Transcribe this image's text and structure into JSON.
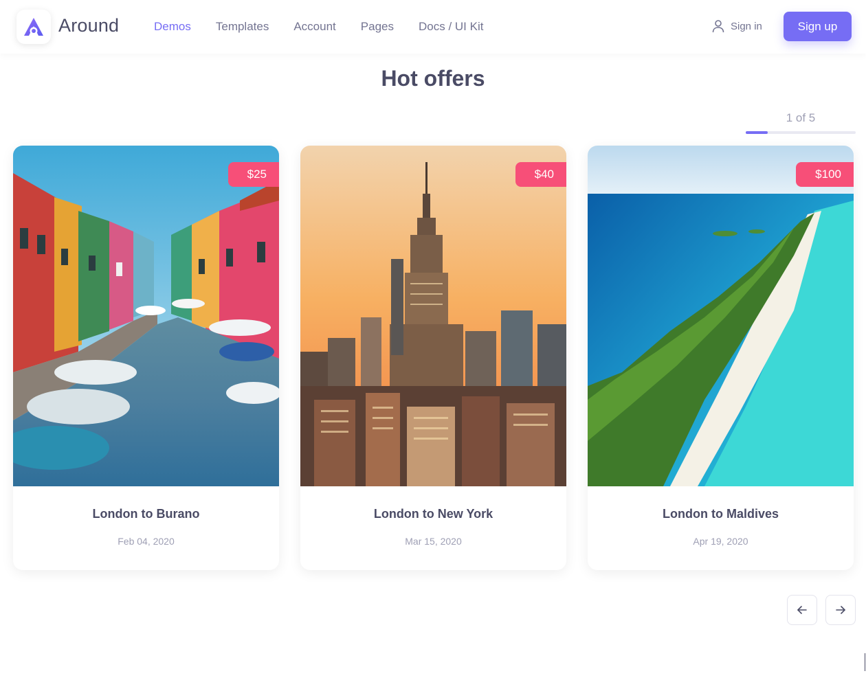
{
  "brand": {
    "name": "Around",
    "logo_icon": "around-logo-icon"
  },
  "nav": {
    "items": [
      {
        "label": "Demos",
        "active": true
      },
      {
        "label": "Templates",
        "active": false
      },
      {
        "label": "Account",
        "active": false
      },
      {
        "label": "Pages",
        "active": false
      },
      {
        "label": "Docs / UI Kit",
        "active": false
      }
    ],
    "signin_label": "Sign in",
    "signin_icon": "user-icon",
    "signup_label": "Sign up"
  },
  "section": {
    "title": "Hot offers"
  },
  "pager": {
    "label": "1 of 5",
    "current": 1,
    "total": 5,
    "progress": 0.2
  },
  "cards": [
    {
      "price": "$25",
      "title": "London to Burano",
      "date": "Feb 04, 2020",
      "image": "colorful canal houses with boats"
    },
    {
      "price": "$40",
      "title": "London to New York",
      "date": "Mar 15, 2020",
      "image": "city skyline at sunset"
    },
    {
      "price": "$100",
      "title": "London to Maldives",
      "date": "Apr 19, 2020",
      "image": "tropical island aerial view"
    }
  ],
  "controls": {
    "prev_icon": "arrow-left-icon",
    "next_icon": "arrow-right-icon"
  },
  "colors": {
    "accent": "#766df4",
    "badge": "#f74f78",
    "text": "#4a4b65",
    "muted": "#9e9fb4"
  }
}
